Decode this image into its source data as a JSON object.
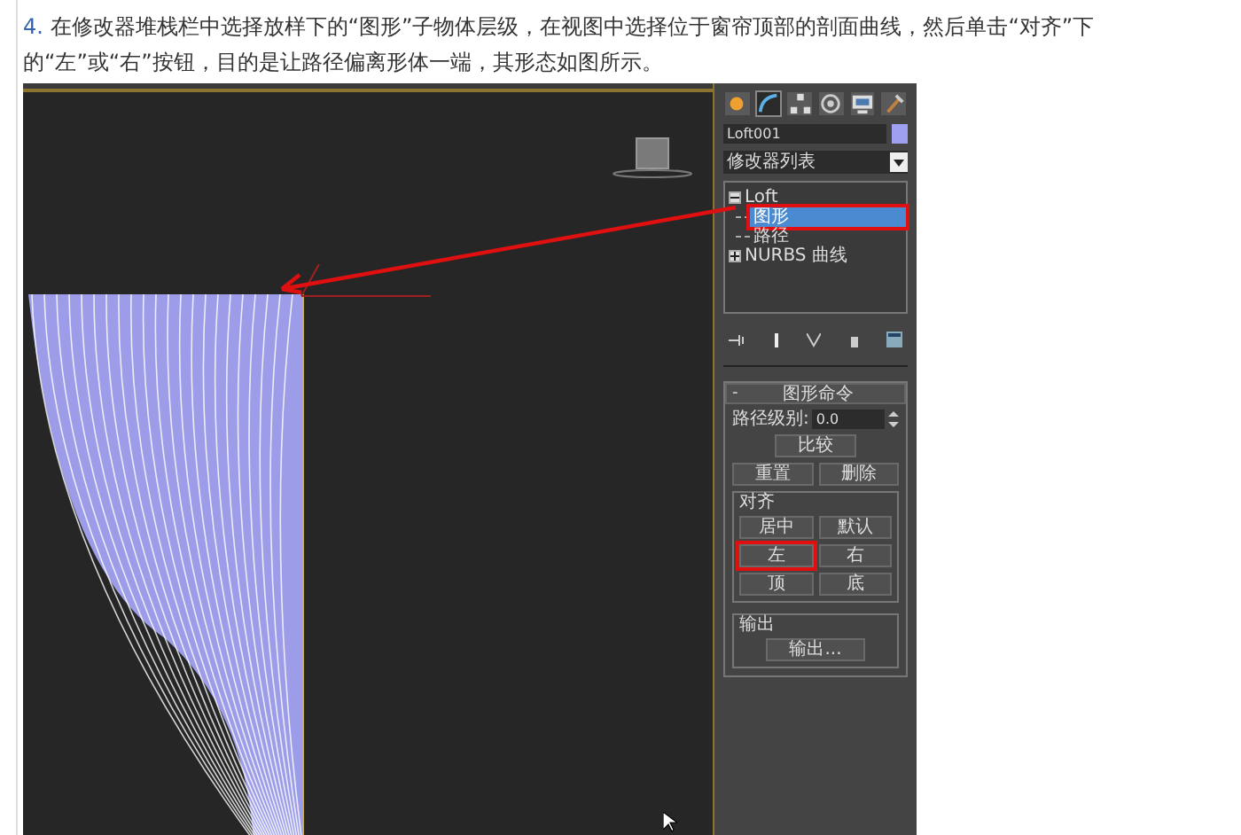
{
  "step": {
    "number": "4.",
    "text": "在修改器堆栈栏中选择放样下的“图形”子物体层级，在视图中选择位于窗帘顶部的剖面曲线，然后单击“对齐”下的“左”或“右”按钮，目的是让路径偏离形体一端，其形态如图所示。"
  },
  "panel": {
    "command_tabs": [
      {
        "selected": false
      },
      {
        "selected": true
      },
      {
        "selected": false
      },
      {
        "selected": false
      },
      {
        "selected": false
      },
      {
        "selected": false
      }
    ],
    "object_name": "Loft001",
    "modifier_list": "修改器列表",
    "stack": [
      {
        "label": "Loft",
        "expanded": true,
        "selected": false,
        "children": [
          {
            "label": "图形",
            "selected": true,
            "callout": true
          },
          {
            "label": "路径",
            "selected": false,
            "callout": false
          }
        ]
      },
      {
        "label": "NURBS 曲线",
        "expanded": false,
        "selected": false
      }
    ],
    "rollout": {
      "title": "图形命令",
      "collapse": "-",
      "path_level_label": "路径级别:",
      "path_level": "0.0",
      "compare": "比较",
      "reset": "重置",
      "delete": "删除",
      "align_group": "对齐",
      "align_buttons": [
        {
          "label": "居中",
          "callout": false
        },
        {
          "label": "默认",
          "callout": false
        },
        {
          "label": "左",
          "callout": true
        },
        {
          "label": "右",
          "callout": false
        },
        {
          "label": "顶",
          "callout": false
        },
        {
          "label": "底",
          "callout": false
        }
      ],
      "output_group": "输出",
      "output_button": "输出..."
    }
  }
}
